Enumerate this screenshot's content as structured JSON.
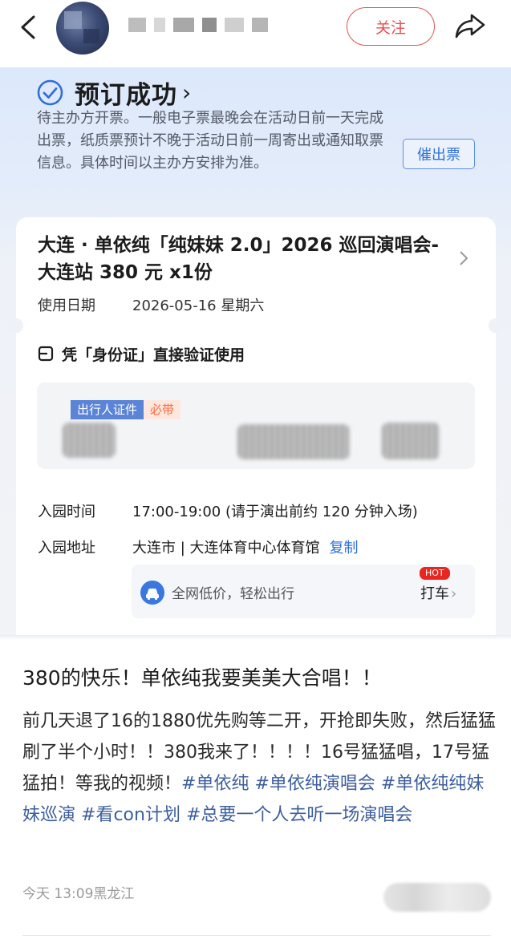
{
  "header": {
    "follow_label": "关注"
  },
  "order": {
    "status_title": "预订成功",
    "status_arrow": "›",
    "status_desc": "待主办方开票。一般电子票最晚会在活动日前一天完成出票，纸质票预计不晚于活动日前一周寄出或通知取票信息。具体时间以主办方安排为准。",
    "urge_label": "催出票",
    "ticket_title": "大连 · 单依纯「纯妹妹 2.0」2026 巡回演唱会-大连站 380 元 x1份",
    "use_date_label": "使用日期",
    "use_date_value": "2026-05-16 星期六",
    "verify_text": "凭「身份证」直接验证使用",
    "id_tag": "出行人证件",
    "id_required": "必带",
    "entry_time_label": "入园时间",
    "entry_time_value": "17:00-19:00 (请于演出前约 120 分钟入场)",
    "entry_addr_label": "入园地址",
    "entry_addr_value": "大连市 | 大连体育中心体育馆",
    "copy_label": "复制",
    "taxi_text": "全网低价，轻松出行",
    "taxi_action": "打车",
    "hot_badge": "HOT"
  },
  "post": {
    "title": "380的快乐！单依纯我要美美大合唱！！",
    "body": "前几天退了16的1880优先购等二开，开抢即失败，然后猛猛刷了半个小时！！380我来了！！！！16号猛猛唱，17号猛猛拍！等我的视频！",
    "tags": [
      "#单依纯",
      "#单依纯演唱会",
      "#单依纯纯妹妹巡演",
      "#看con计划",
      "#总要一个人去听一场演唱会"
    ],
    "meta": "今天 13:09黑龙江"
  },
  "colors": {
    "accent_red": "#e6504f",
    "link_blue": "#2f6fd8",
    "tag_blue": "#3d5f9c"
  },
  "icons": [
    "back-arrow-icon",
    "share-icon",
    "check-circle-icon",
    "chevron-right-icon",
    "id-card-icon",
    "car-icon"
  ]
}
